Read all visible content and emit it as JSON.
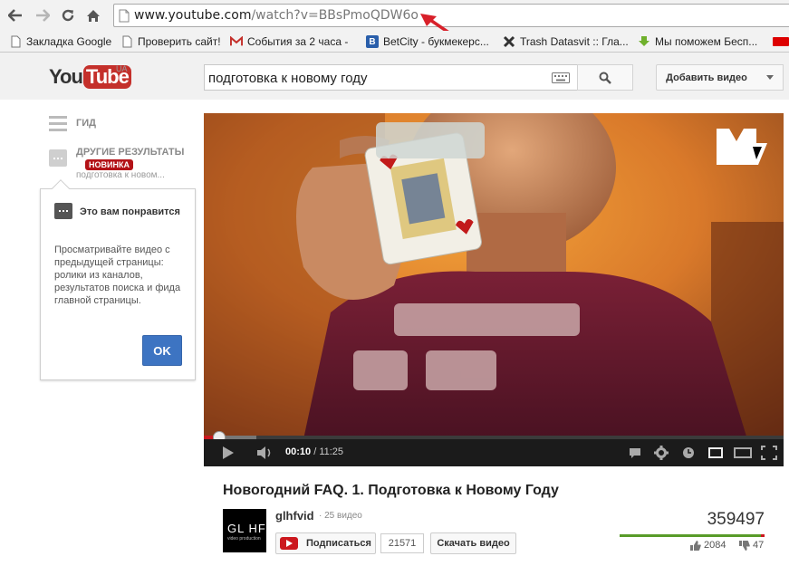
{
  "browser": {
    "url_host": "www.youtube.com",
    "url_path": "/watch?v=BBsPmoQDW6o",
    "bookmarks": [
      {
        "label": "Закладка Google",
        "icon": "page-icon"
      },
      {
        "label": "Проверить сайт!",
        "icon": "page-icon"
      },
      {
        "label": "События за 2 часа -",
        "icon": "gmail-icon"
      },
      {
        "label": "BetCity - букмекерс...",
        "icon": "betcity-icon"
      },
      {
        "label": "Trash Datasvit :: Гла...",
        "icon": "x-logo-icon"
      },
      {
        "label": "Мы поможем Бесп...",
        "icon": "download-arrow-icon"
      }
    ]
  },
  "youtube": {
    "logo_you": "You",
    "logo_tube": "Tube",
    "logo_region": "UA",
    "search_query": "подготовка к новому году",
    "upload_label": "Добавить видео"
  },
  "guide": {
    "guide_label": "ГИД",
    "more_results_label": "ДРУГИЕ РЕЗУЛЬТАТЫ",
    "new_badge": "НОВИНКА",
    "more_results_sub": "подготовка к новом..."
  },
  "tooltip": {
    "title": "Это вам понравится",
    "body": "Просматривайте видео с предыдущей страницы: ролики из каналов, результатов поиска и фида главной страницы.",
    "ok_label": "OK"
  },
  "player": {
    "current_time": "00:10",
    "duration": "/ 11:25",
    "progress_fraction": 0.015,
    "buffered_fraction": 0.09,
    "overlay_logo": "MTV"
  },
  "video": {
    "title": "Новогодний FAQ. 1. Подготовка к Новому Году",
    "channel": "glhfvid",
    "channel_videos": "· 25 видео",
    "avatar_text": "GL HF",
    "avatar_subtext": "video production",
    "subscribe_label": "Подписаться",
    "subscriber_count": "21571",
    "download_label": "Скачать видео",
    "views": "359497",
    "likes": "2084",
    "dislikes": "47",
    "like_fraction": 0.978
  },
  "colors": {
    "brand_red": "#cc181e",
    "link_blue": "#3d74c2",
    "like_green": "#589b29"
  }
}
